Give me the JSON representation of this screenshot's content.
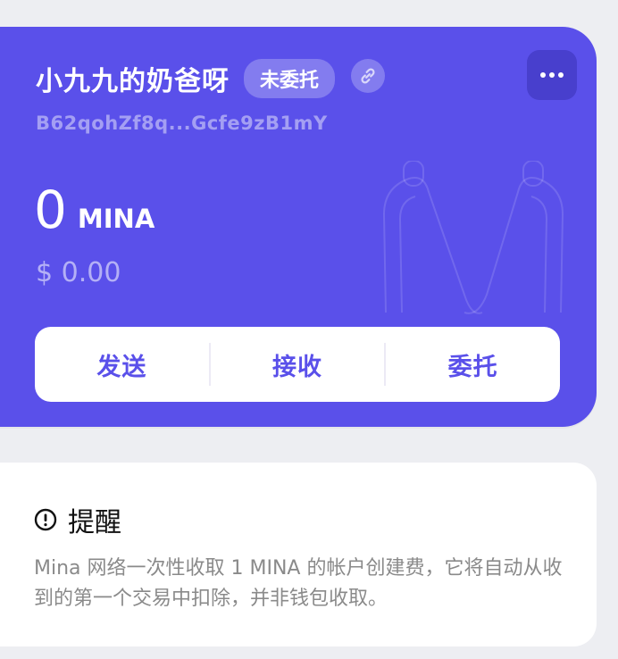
{
  "wallet": {
    "account_name": "小九九的奶爸呀",
    "delegation_status": "未委托",
    "address": "B62qohZf8q...Gcfe9zB1mY",
    "balance_amount": "0",
    "balance_unit": "MINA",
    "fiat_value": "$ 0.00",
    "icons": {
      "link": "link-icon",
      "more": "more-dots-icon",
      "watermark": "mina-logo-watermark"
    },
    "actions": [
      {
        "label": "发送"
      },
      {
        "label": "接收"
      },
      {
        "label": "委托"
      }
    ],
    "colors": {
      "card": "#5a50ea",
      "action_text": "#5a50ea"
    }
  },
  "notice": {
    "icon": "exclamation-circle-icon",
    "title": "提醒",
    "body": "Mina 网络一次性收取 1 MINA 的帐户创建费，它将自动从收到的第一个交易中扣除，并非钱包收取。"
  }
}
